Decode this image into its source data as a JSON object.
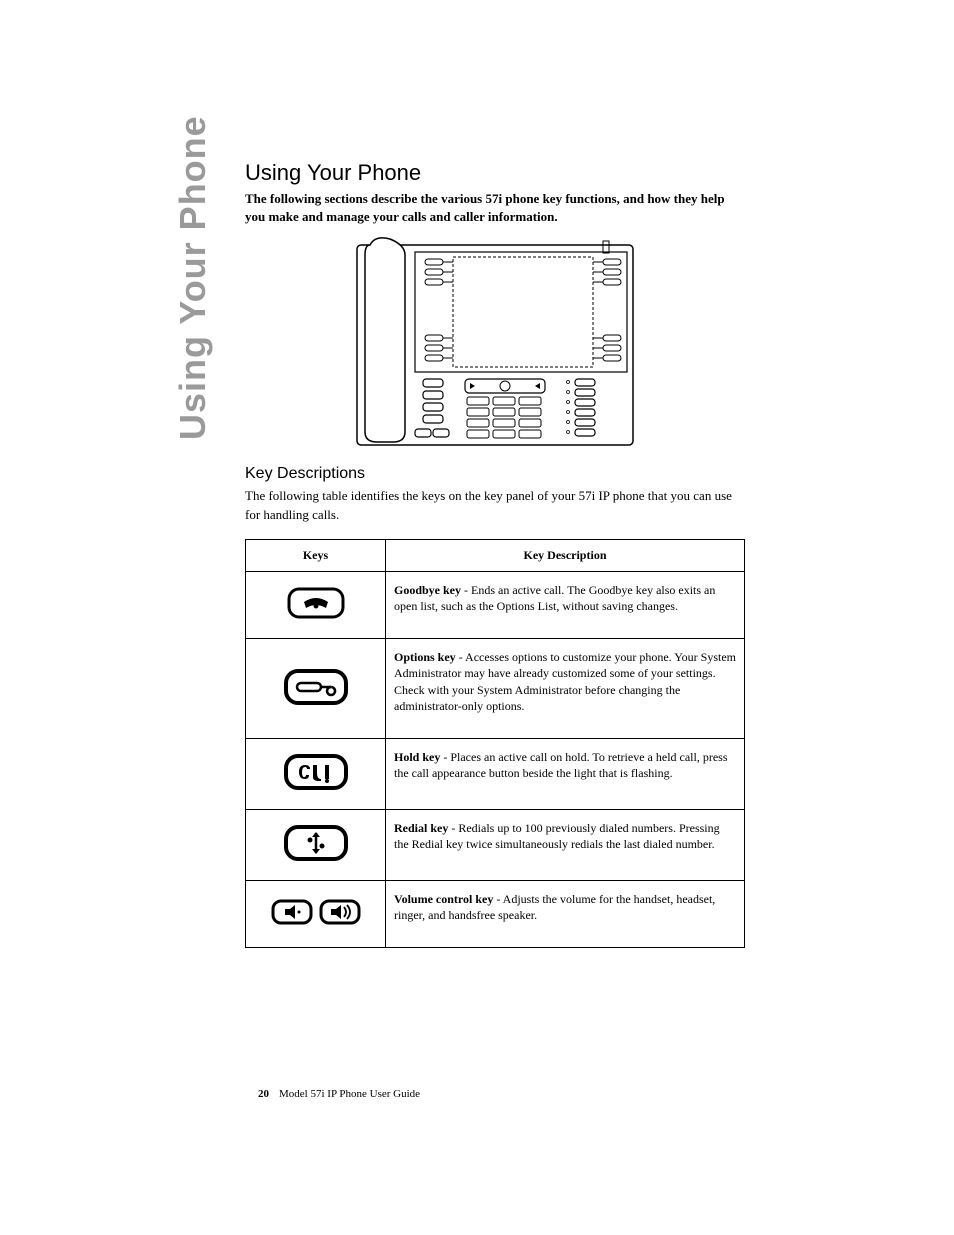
{
  "sidebar_title": "Using Your Phone",
  "heading": "Using Your Phone",
  "intro": "The following sections describe the various 57i phone key functions, and how they help you make and manage your calls and caller information.",
  "subheading": "Key Descriptions",
  "subintro": "The following table identifies the keys on the key panel of your 57i IP phone that you can use for handling calls.",
  "table": {
    "headers": {
      "keys": "Keys",
      "desc": "Key Description"
    },
    "rows": [
      {
        "icon": "goodbye-key-icon",
        "name": "Goodbye key",
        "text": " - Ends an active call. The Goodbye key also exits an open list, such as the Options List, without saving changes."
      },
      {
        "icon": "options-key-icon",
        "name": "Options key",
        "text": " - Accesses options to customize your phone. Your System Administrator may have already customized some of your settings. Check with your System Administrator before changing the administrator-only options."
      },
      {
        "icon": "hold-key-icon",
        "name": "Hold key",
        "text": " - Places an active call on hold. To retrieve a held call, press the call appearance button beside the light that is flashing."
      },
      {
        "icon": "redial-key-icon",
        "name": "Redial key",
        "text": " - Redials up to 100 previously dialed numbers. Pressing the Redial key twice simultaneously redials the last dialed number."
      },
      {
        "icon": "volume-key-icon",
        "name": "Volume control key",
        "text": " - Adjusts the volume for the handset, headset, ringer, and handsfree speaker."
      }
    ]
  },
  "footer": {
    "page": "20",
    "title": "Model 57i IP Phone User Guide"
  }
}
